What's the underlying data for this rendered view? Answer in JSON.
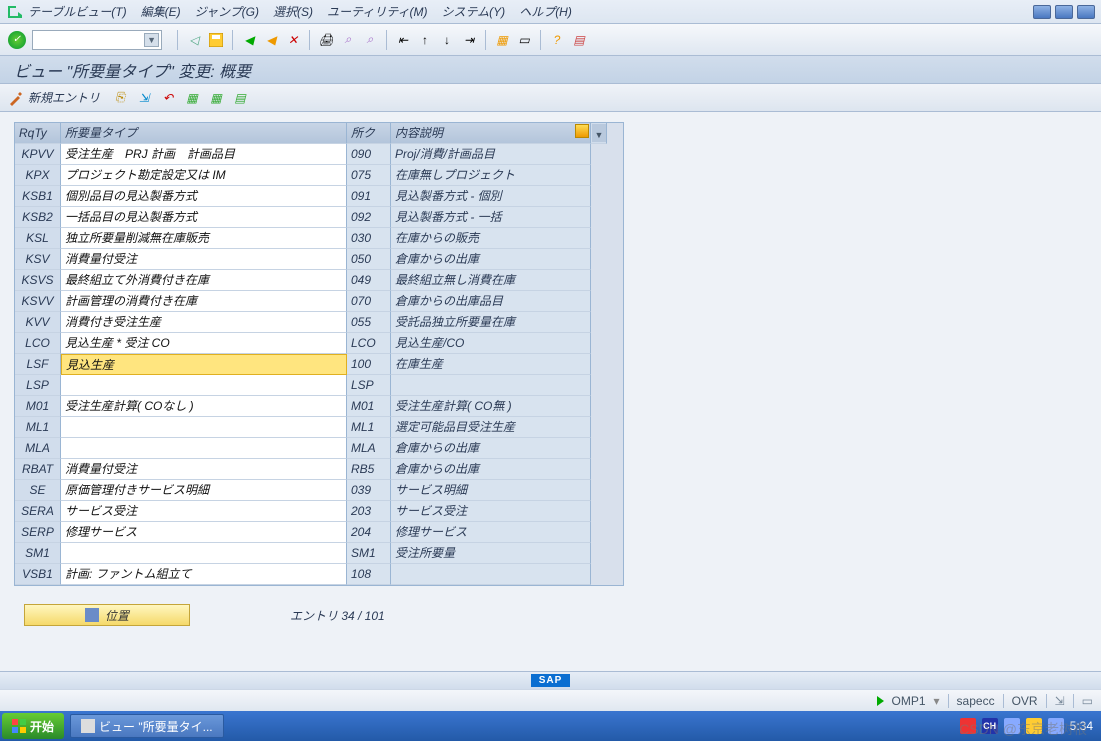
{
  "menu": {
    "items": [
      "テーブルビュー(T)",
      "編集(E)",
      "ジャンプ(G)",
      "選択(S)",
      "ユーティリティ(M)",
      "システム(Y)",
      "ヘルプ(H)"
    ]
  },
  "title": "ビュー \"所要量タイプ\" 変更: 概要",
  "secondary": {
    "new_entry_label": "新規エントリ"
  },
  "columns": {
    "c1": "RqTy",
    "c2": "所要量タイプ",
    "c3": "所ク",
    "c4": "内容説明"
  },
  "rows": [
    {
      "k": "KPVV",
      "t": "受注生産　PRJ 計画　計画品目",
      "c": "090",
      "d": "Proj/消費/計画品目"
    },
    {
      "k": "KPX",
      "t": "プロジェクト勘定設定又は IM",
      "c": "075",
      "d": "在庫無しプロジェクト"
    },
    {
      "k": "KSB1",
      "t": "個別品目の見込製番方式",
      "c": "091",
      "d": "見込製番方式 - 個別"
    },
    {
      "k": "KSB2",
      "t": "一括品目の見込製番方式",
      "c": "092",
      "d": "見込製番方式 - 一括"
    },
    {
      "k": "KSL",
      "t": "独立所要量削減無在庫販売",
      "c": "030",
      "d": "在庫からの販売"
    },
    {
      "k": "KSV",
      "t": "消費量付受注",
      "c": "050",
      "d": "倉庫からの出庫"
    },
    {
      "k": "KSVS",
      "t": "最終組立て外消費付き在庫",
      "c": "049",
      "d": "最終組立無し消費在庫"
    },
    {
      "k": "KSVV",
      "t": "計画管理の消費付き在庫",
      "c": "070",
      "d": "倉庫からの出庫品目"
    },
    {
      "k": "KVV",
      "t": "消費付き受注生産",
      "c": "055",
      "d": "受託品独立所要量在庫"
    },
    {
      "k": "LCO",
      "t": "見込生産 * 受注 CO",
      "c": "LCO",
      "d": "見込生産/CO"
    },
    {
      "k": "LSF",
      "t": "見込生産",
      "c": "100",
      "d": "在庫生産",
      "hl": true
    },
    {
      "k": "LSP",
      "t": "",
      "c": "LSP",
      "d": ""
    },
    {
      "k": "M01",
      "t": "受注生産計算( COなし )",
      "c": "M01",
      "d": "受注生産計算( CO無 )"
    },
    {
      "k": "ML1",
      "t": "",
      "c": "ML1",
      "d": "選定可能品目受注生産"
    },
    {
      "k": "MLA",
      "t": "",
      "c": "MLA",
      "d": "倉庫からの出庫"
    },
    {
      "k": "RBAT",
      "t": "消費量付受注",
      "c": "RB5",
      "d": "倉庫からの出庫"
    },
    {
      "k": "SE",
      "t": "原価管理付きサービス明細",
      "c": "039",
      "d": "サービス明細"
    },
    {
      "k": "SERA",
      "t": "サービス受注",
      "c": "203",
      "d": "サービス受注"
    },
    {
      "k": "SERP",
      "t": "修理サービス",
      "c": "204",
      "d": "修理サービス"
    },
    {
      "k": "SM1",
      "t": "",
      "c": "SM1",
      "d": "受注所要量"
    },
    {
      "k": "VSB1",
      "t": "計画: ファントム組立て",
      "c": "108",
      "d": ""
    }
  ],
  "footer": {
    "position_label": "位置",
    "entry_text": "エントリ 34 / 101"
  },
  "status": {
    "system": "OMP1",
    "client": "sapecc",
    "mode": "OVR"
  },
  "watermark": "CSDN @东京老树根",
  "taskbar": {
    "start": "开始",
    "task1": "ビュー \"所要量タイ...",
    "time": "5:34"
  }
}
